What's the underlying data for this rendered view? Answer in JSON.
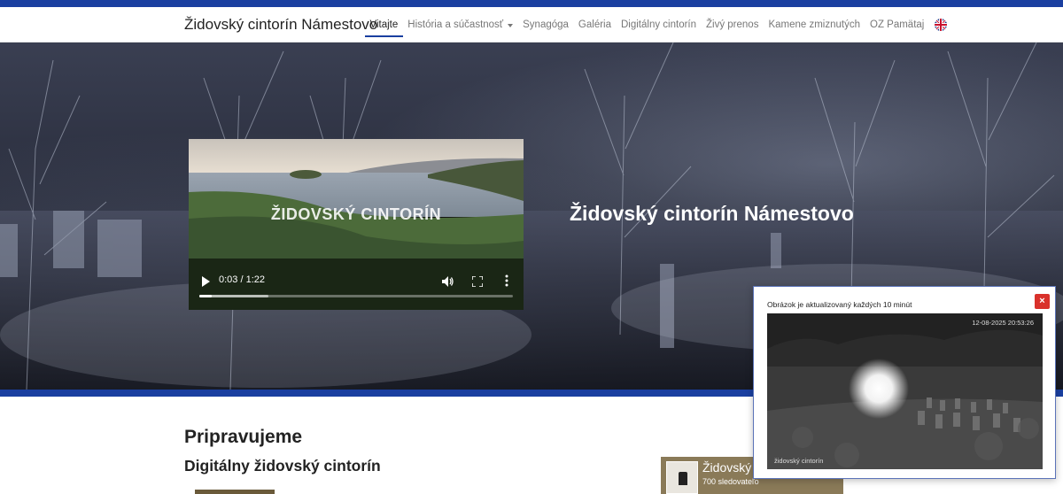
{
  "navbar": {
    "brand": "Židovský cintorín Námestovo",
    "items": [
      {
        "label": "Vitajte",
        "active": true
      },
      {
        "label": "História a súčastnosť",
        "dropdown": true
      },
      {
        "label": "Synagóga"
      },
      {
        "label": "Galéria"
      },
      {
        "label": "Digitálny cintorín"
      },
      {
        "label": "Živý prenos"
      },
      {
        "label": "Kamene zmiznutých"
      },
      {
        "label": "OZ Pamätaj"
      }
    ],
    "language_icon": "uk-flag-icon"
  },
  "hero": {
    "title": "Židovský cintorín Námestovo",
    "video": {
      "overlay_title": "ŽIDOVSKÝ CINTORÍN",
      "time": "0:03 / 1:22",
      "progress_fraction": 0.04,
      "buffered_fraction": 0.22
    }
  },
  "main": {
    "heading": "Pripravujeme",
    "subheading": "Digitálny židovský cintorín"
  },
  "facebook": {
    "page_name": "Židovský c",
    "followers": "700 sledovateľo"
  },
  "popup": {
    "text": "Obrázok je aktualizovaný každých 10 minút",
    "close_label": "×",
    "camera_timestamp": "12-08-2025 20:53:26",
    "camera_label": "židovský cintorín"
  },
  "colors": {
    "accent": "#1a3fa0",
    "close_button": "#d9312b"
  }
}
